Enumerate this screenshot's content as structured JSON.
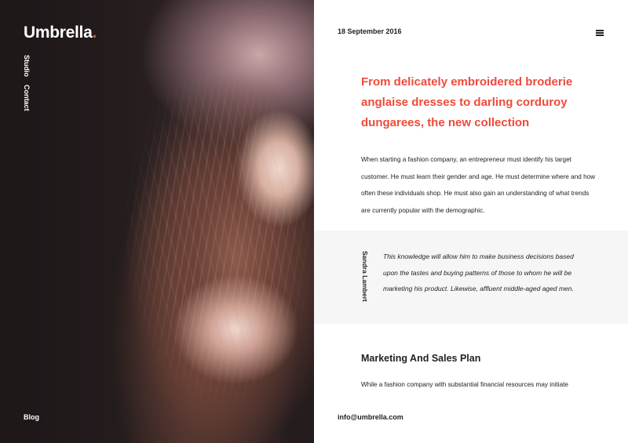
{
  "brand": {
    "name": "Umbrella",
    "dot": ".",
    "accent_color": "#f04a3a"
  },
  "side_nav": {
    "items": [
      {
        "label": "Studio"
      },
      {
        "label": "Contact"
      }
    ],
    "bottom_link": "Blog"
  },
  "hero_image": {
    "alt": "Portrait of a woman with long wavy auburn hair"
  },
  "article": {
    "date": "18 September 2016",
    "menu_icon": "hamburger-menu-icon",
    "headline": "From delicately embroidered broderie anglaise dresses to darling corduroy dungarees, the new collection",
    "intro": "When starting a fashion company, an entrepreneur must identify his target customer. He must learn their gender and age. He must determine where and how often these individuals shop. He must also gain an understanding of what trends are currently popular with the demographic.",
    "quote": {
      "author": "Sandra Lambert",
      "text": "This knowledge will allow him to make business decisions based upon the tastes and buying patterns of those to whom he will be marketing his product. Likewise, affluent middle-aged aged men."
    },
    "section_title": "Marketing And Sales Plan",
    "section_excerpt": "While a fashion company with substantial financial resources may initiate"
  },
  "footer": {
    "email": "info@umbrella.com"
  }
}
